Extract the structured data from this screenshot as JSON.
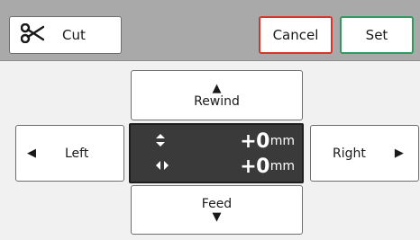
{
  "toolbar": {
    "cut_label": "Cut",
    "cancel_label": "Cancel",
    "set_label": "Set"
  },
  "controls": {
    "rewind_label": "Rewind",
    "feed_label": "Feed",
    "left_label": "Left",
    "right_label": "Right"
  },
  "readout": {
    "vertical_value": "+0",
    "horizontal_value": "+0",
    "unit": "mm"
  },
  "icons": {
    "cut": "scissors-icon",
    "vertical": "updown-arrow-icon",
    "horizontal": "leftright-arrow-icon"
  },
  "colors": {
    "cancel_border": "#d9342b",
    "set_border": "#2e9a5e",
    "header_bg": "#a9a9a9",
    "readout_bg": "#3a3a3a"
  }
}
